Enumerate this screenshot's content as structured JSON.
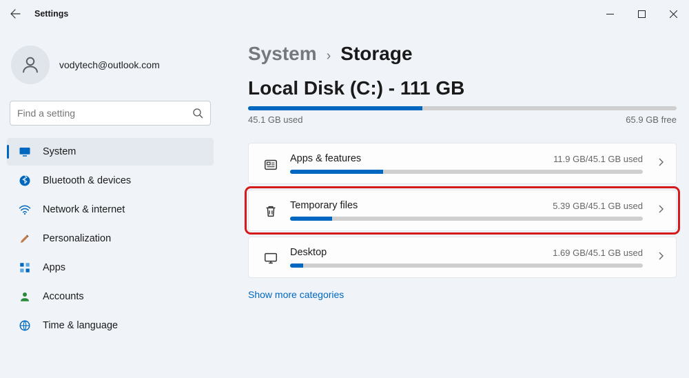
{
  "window": {
    "title": "Settings"
  },
  "account": {
    "email": "vodytech@outlook.com"
  },
  "search": {
    "placeholder": "Find a setting"
  },
  "nav": {
    "items": [
      {
        "label": "System",
        "icon": "monitor",
        "selected": true
      },
      {
        "label": "Bluetooth & devices",
        "icon": "bluetooth",
        "selected": false
      },
      {
        "label": "Network & internet",
        "icon": "wifi",
        "selected": false
      },
      {
        "label": "Personalization",
        "icon": "brush",
        "selected": false
      },
      {
        "label": "Apps",
        "icon": "grid",
        "selected": false
      },
      {
        "label": "Accounts",
        "icon": "person",
        "selected": false
      },
      {
        "label": "Time & language",
        "icon": "globe",
        "selected": false
      }
    ]
  },
  "breadcrumb": {
    "parent": "System",
    "current": "Storage"
  },
  "disk": {
    "title": "Local Disk (C:) - 111 GB",
    "used_label": "45.1 GB used",
    "free_label": "65.9 GB free",
    "used_gb": 45.1,
    "free_gb": 65.9,
    "total_gb": 111,
    "fill_pct": 40.6
  },
  "categories": [
    {
      "name": "Apps & features",
      "usage_label": "11.9 GB/45.1 GB used",
      "fill_pct": 26.4,
      "highlighted": false,
      "icon": "apps"
    },
    {
      "name": "Temporary files",
      "usage_label": "5.39 GB/45.1 GB used",
      "fill_pct": 12.0,
      "highlighted": true,
      "icon": "trash"
    },
    {
      "name": "Desktop",
      "usage_label": "1.69 GB/45.1 GB used",
      "fill_pct": 3.8,
      "highlighted": false,
      "icon": "desktop"
    }
  ],
  "more_link": "Show more categories"
}
